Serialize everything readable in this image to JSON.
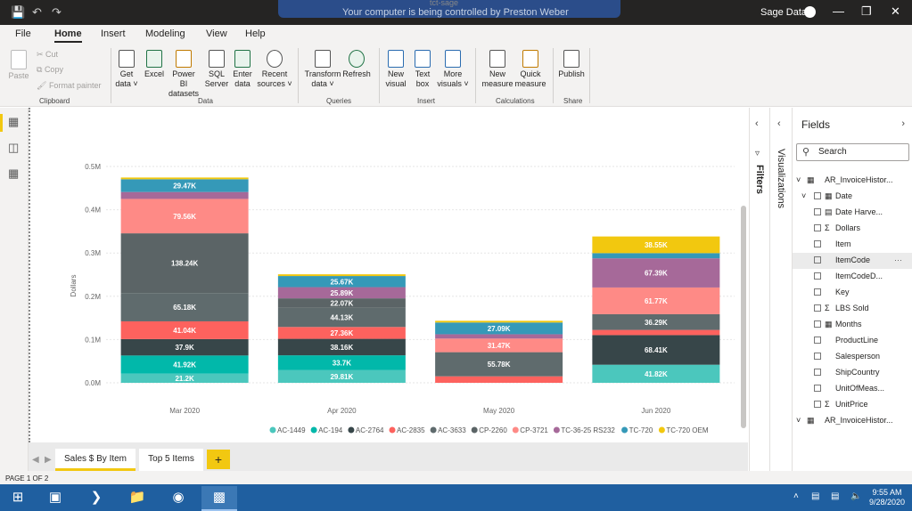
{
  "titlebar": {
    "remote_text": "Your computer is being controlled by Preston Weber",
    "doc_title": "tct-sage",
    "user": "Sage Data"
  },
  "menu": {
    "items": [
      "File",
      "Home",
      "Insert",
      "Modeling",
      "View",
      "Help"
    ]
  },
  "ribbon": {
    "clipboard": {
      "paste": "Paste",
      "cut": "Cut",
      "copy": "Copy",
      "format_painter": "Format painter",
      "group": "Clipboard"
    },
    "data": {
      "get_data_1": "Get",
      "get_data_2": "data ˅",
      "excel": "Excel",
      "pbi_1": "Power BI",
      "pbi_2": "datasets",
      "sql_1": "SQL",
      "sql_2": "Server",
      "enter_1": "Enter",
      "enter_2": "data",
      "recent_1": "Recent",
      "recent_2": "sources ˅",
      "group": "Data"
    },
    "queries": {
      "transform_1": "Transform",
      "transform_2": "data ˅",
      "refresh": "Refresh",
      "group": "Queries"
    },
    "insert": {
      "newvis_1": "New",
      "newvis_2": "visual",
      "textbox_1": "Text",
      "textbox_2": "box",
      "more_1": "More",
      "more_2": "visuals ˅",
      "group": "Insert"
    },
    "calculations": {
      "newmeasure_1": "New",
      "newmeasure_2": "measure",
      "quick_1": "Quick",
      "quick_2": "measure",
      "group": "Calculations"
    },
    "share": {
      "publish": "Publish",
      "group": "Share"
    }
  },
  "chart_data": {
    "type": "bar",
    "stacked": true,
    "categories": [
      "Mar 2020",
      "Apr 2020",
      "May 2020",
      "Jun 2020"
    ],
    "ylabel": "Dollars",
    "ylim": [
      0,
      0.5
    ],
    "yticks": [
      "0.0M",
      "0.1M",
      "0.2M",
      "0.3M",
      "0.4M",
      "0.5M"
    ],
    "legend_position": "bottom",
    "series": [
      {
        "name": "AC-1449",
        "color": "#4bc7bd",
        "values": [
          21200,
          29810,
          0,
          41820
        ],
        "labels": [
          "21.2K",
          "29.81K",
          "",
          "41.82K"
        ]
      },
      {
        "name": "AC-194",
        "color": "#01b8aa",
        "values": [
          41920,
          33700,
          0,
          0
        ],
        "labels": [
          "41.92K",
          "33.7K",
          "",
          ""
        ]
      },
      {
        "name": "AC-2764",
        "color": "#374649",
        "values": [
          37900,
          38160,
          0,
          68410
        ],
        "labels": [
          "37.9K",
          "38.16K",
          "",
          "68.41K"
        ]
      },
      {
        "name": "AC-2835",
        "color": "#fd625e",
        "values": [
          41040,
          27360,
          15000,
          12000
        ],
        "labels": [
          "41.04K",
          "27.36K",
          "",
          ""
        ]
      },
      {
        "name": "AC-3633",
        "color": "#5f6b6d",
        "values": [
          65180,
          44130,
          55780,
          36290
        ],
        "labels": [
          "65.18K",
          "44.13K",
          "55.78K",
          "36.29K"
        ]
      },
      {
        "name": "CP-2260",
        "color": "#5b6466",
        "values": [
          138240,
          22070,
          0,
          0
        ],
        "labels": [
          "138.24K",
          "22.07K",
          "",
          ""
        ]
      },
      {
        "name": "CP-3721",
        "color": "#fe8a86",
        "values": [
          79560,
          0,
          31470,
          61770
        ],
        "labels": [
          "79.56K",
          "",
          "31.47K",
          "61.77K"
        ]
      },
      {
        "name": "TC-36-25 RS232",
        "color": "#a66999",
        "values": [
          16000,
          25890,
          10000,
          67390
        ],
        "labels": [
          "",
          "25.89K",
          "",
          "67.39K"
        ]
      },
      {
        "name": "TC-720",
        "color": "#3599b8",
        "values": [
          29470,
          25670,
          27090,
          12000
        ],
        "labels": [
          "29.47K",
          "25.67K",
          "27.09K",
          ""
        ]
      },
      {
        "name": "TC-720 OEM",
        "color": "#f2c80f",
        "values": [
          4000,
          4000,
          4000,
          38550
        ],
        "labels": [
          "",
          "",
          "",
          "38.55K"
        ]
      }
    ]
  },
  "tabs": {
    "sheet1": "Sales $ By Item",
    "sheet2": "Top 5 Items",
    "add": "+"
  },
  "status": {
    "page": "PAGE 1 OF 2"
  },
  "panes": {
    "filters": "Filters",
    "visualizations": "Visualizations",
    "fields": "Fields",
    "search_placeholder": "Search"
  },
  "fields": [
    {
      "label": "AR_InvoiceHistor...",
      "kind": "table",
      "level": 0
    },
    {
      "label": "Date",
      "kind": "date",
      "level": 1
    },
    {
      "label": "Date Harve...",
      "kind": "calc",
      "level": 1
    },
    {
      "label": "Dollars",
      "kind": "sum",
      "level": 1
    },
    {
      "label": "Item",
      "kind": "field",
      "level": 1
    },
    {
      "label": "ItemCode",
      "kind": "field",
      "level": 1
    },
    {
      "label": "ItemCodeD...",
      "kind": "field",
      "level": 1
    },
    {
      "label": "Key",
      "kind": "field",
      "level": 1
    },
    {
      "label": "LBS Sold",
      "kind": "sum",
      "level": 1
    },
    {
      "label": "Months",
      "kind": "table",
      "level": 1
    },
    {
      "label": "ProductLine",
      "kind": "field",
      "level": 1
    },
    {
      "label": "Salesperson",
      "kind": "field",
      "level": 1
    },
    {
      "label": "ShipCountry",
      "kind": "field",
      "level": 1
    },
    {
      "label": "UnitOfMeas...",
      "kind": "field",
      "level": 1
    },
    {
      "label": "UnitPrice",
      "kind": "sum",
      "level": 1
    },
    {
      "label": "AR_InvoiceHistor...",
      "kind": "table",
      "level": 0
    }
  ],
  "taskbar": {
    "time": "9:55 AM",
    "date": "9/28/2020"
  }
}
